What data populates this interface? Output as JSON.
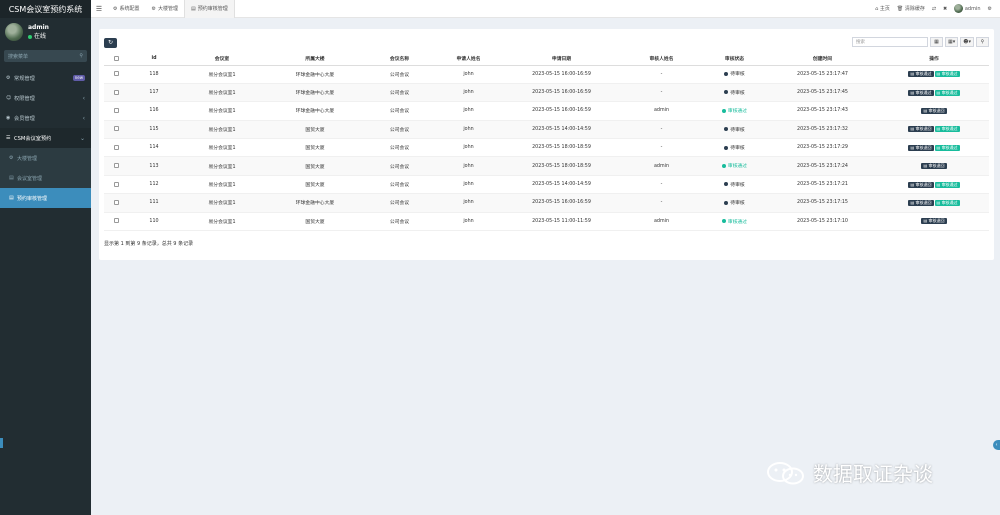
{
  "app": {
    "title": "CSM会议室预约系统"
  },
  "user": {
    "name": "admin",
    "status": "在线"
  },
  "sidebar": {
    "search_placeholder": "搜索菜单",
    "items": [
      {
        "label": "常规管理",
        "icon": "gear-icon",
        "badge": "new"
      },
      {
        "label": "权限管理",
        "icon": "users-icon"
      },
      {
        "label": "会员管理",
        "icon": "user-circle-icon"
      },
      {
        "label": "CSM会议室预约",
        "icon": "list-icon",
        "open": true
      }
    ],
    "sub_items": [
      {
        "label": "大楼管理",
        "icon": "gear-icon"
      },
      {
        "label": "会议室管理",
        "icon": "file-icon"
      },
      {
        "label": "预约审核管理",
        "icon": "file-icon",
        "active": true
      }
    ]
  },
  "topbar": {
    "tabs": [
      {
        "label": "系统配置",
        "icon": "gear-icon"
      },
      {
        "label": "大楼管理",
        "icon": "gear-icon"
      },
      {
        "label": "预约审核管理",
        "icon": "file-icon",
        "active": true
      }
    ],
    "home": "主页",
    "clear_cache": "清除缓存",
    "admin": "admin"
  },
  "toolbar": {
    "search_placeholder": "搜索"
  },
  "table": {
    "headers": [
      "id",
      "会议室",
      "所属大楼",
      "会议名称",
      "申请人姓名",
      "申请日期",
      "审核人姓名",
      "审核状态",
      "创建时间",
      "操作"
    ],
    "rows": [
      {
        "id": "118",
        "room": "易分会议室1",
        "building": "环球金融中心大厦",
        "meeting": "公司会议",
        "applicant": "john",
        "date": "2023-05-15 16:00-16:59",
        "reviewer": "-",
        "status": "待审核",
        "status_type": "pending",
        "created": "2023-05-15 23:17:47",
        "actions": [
          "审核通过",
          "审核通过"
        ]
      },
      {
        "id": "117",
        "room": "易分会议室1",
        "building": "环球金融中心大厦",
        "meeting": "公司会议",
        "applicant": "john",
        "date": "2023-05-15 16:00-16:59",
        "reviewer": "-",
        "status": "待审核",
        "status_type": "pending",
        "created": "2023-05-15 23:17:45",
        "actions": [
          "审核通过",
          "审核通过"
        ]
      },
      {
        "id": "116",
        "room": "易分会议室1",
        "building": "环球金融中心大厦",
        "meeting": "公司会议",
        "applicant": "john",
        "date": "2023-05-15 16:00-16:59",
        "reviewer": "admin",
        "status": "审核通过",
        "status_type": "ok",
        "created": "2023-05-15 23:17:43",
        "actions": [
          "审核退回"
        ]
      },
      {
        "id": "115",
        "room": "易分会议室1",
        "building": "国贸大厦",
        "meeting": "公司会议",
        "applicant": "john",
        "date": "2023-05-15 14:00-14:59",
        "reviewer": "-",
        "status": "待审核",
        "status_type": "pending",
        "created": "2023-05-15 23:17:32",
        "actions": [
          "审核退回",
          "审核通过"
        ]
      },
      {
        "id": "114",
        "room": "易分会议室1",
        "building": "国贸大厦",
        "meeting": "公司会议",
        "applicant": "john",
        "date": "2023-05-15 18:00-18:59",
        "reviewer": "-",
        "status": "待审核",
        "status_type": "pending",
        "created": "2023-05-15 23:17:29",
        "actions": [
          "审核退回",
          "审核通过"
        ]
      },
      {
        "id": "113",
        "room": "易分会议室1",
        "building": "国贸大厦",
        "meeting": "公司会议",
        "applicant": "john",
        "date": "2023-05-15 18:00-18:59",
        "reviewer": "admin",
        "status": "审核通过",
        "status_type": "ok",
        "created": "2023-05-15 23:17:24",
        "actions": [
          "审核退回"
        ]
      },
      {
        "id": "112",
        "room": "易分会议室1",
        "building": "国贸大厦",
        "meeting": "公司会议",
        "applicant": "john",
        "date": "2023-05-15 14:00-14:59",
        "reviewer": "-",
        "status": "待审核",
        "status_type": "pending",
        "created": "2023-05-15 23:17:21",
        "actions": [
          "审核退回",
          "审核通过"
        ]
      },
      {
        "id": "111",
        "room": "易分会议室1",
        "building": "环球金融中心大厦",
        "meeting": "公司会议",
        "applicant": "john",
        "date": "2023-05-15 16:00-16:59",
        "reviewer": "-",
        "status": "待审核",
        "status_type": "pending",
        "created": "2023-05-15 23:17:15",
        "actions": [
          "审核退回",
          "审核通过"
        ]
      },
      {
        "id": "110",
        "room": "易分会议室1",
        "building": "国贸大厦",
        "meeting": "公司会议",
        "applicant": "john",
        "date": "2023-05-15 11:00-11:59",
        "reviewer": "admin",
        "status": "审核通过",
        "status_type": "ok",
        "created": "2023-05-15 23:17:10",
        "actions": [
          "审核退回"
        ]
      }
    ]
  },
  "pager": {
    "info": "显示第 1 到第 9 条记录，总共 9 条记录"
  },
  "watermark": {
    "text": "数据取证杂谈"
  },
  "colors": {
    "sidebar": "#222d32",
    "accent": "#3c8dbc",
    "success": "#18bc9c",
    "dark": "#2c3e50"
  }
}
